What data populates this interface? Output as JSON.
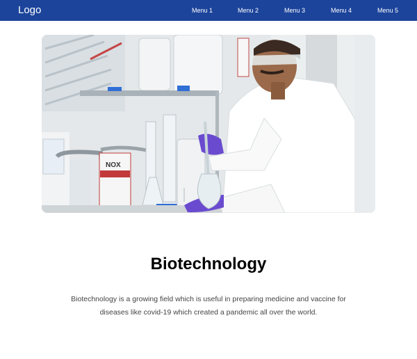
{
  "navbar": {
    "logo": "Logo",
    "menu": [
      "Menu 1",
      "Menu 2",
      "Menu 3",
      "Menu 4",
      "Menu 5"
    ]
  },
  "hero": {
    "label_box": "NOX"
  },
  "content": {
    "title": "Biotechnology",
    "description": "Biotechnology is a growing field which is useful in preparing medicine and vaccine for diseases like covid-19 which created a pandemic all over the world."
  },
  "colors": {
    "navbar": "#1c449b",
    "title": "#000000",
    "text": "#444444",
    "accent_purple_glove": "#6a4bd0",
    "accent_blue": "#2f6fd6"
  }
}
